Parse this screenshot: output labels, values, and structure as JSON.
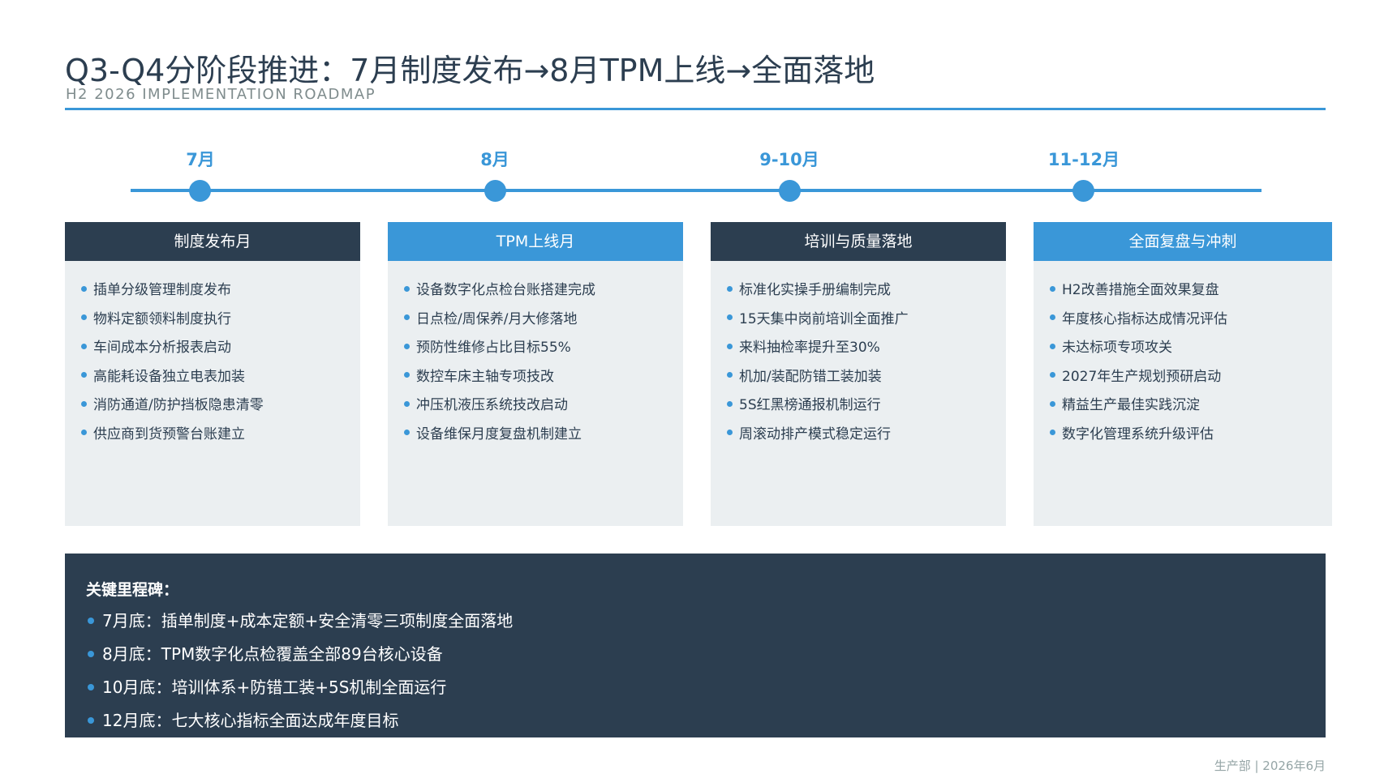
{
  "header": {
    "title": "Q3-Q4分阶段推进：7月制度发布→8月TPM上线→全面落地",
    "subtitle": "H2 2026 IMPLEMENTATION ROADMAP"
  },
  "timeline": {
    "months": [
      "7月",
      "8月",
      "9-10月",
      "11-12月"
    ]
  },
  "phases": [
    {
      "title": "制度发布月",
      "items": [
        "插单分级管理制度发布",
        "物料定额领料制度执行",
        "车间成本分析报表启动",
        "高能耗设备独立电表加装",
        "消防通道/防护挡板隐患清零",
        "供应商到货预警台账建立"
      ]
    },
    {
      "title": "TPM上线月",
      "items": [
        "设备数字化点检台账搭建完成",
        "日点检/周保养/月大修落地",
        "预防性维修占比目标55%",
        "数控车床主轴专项技改",
        "冲压机液压系统技改启动",
        "设备维保月度复盘机制建立"
      ]
    },
    {
      "title": "培训与质量落地",
      "items": [
        "标准化实操手册编制完成",
        "15天集中岗前培训全面推广",
        "来料抽检率提升至30%",
        "机加/装配防错工装加装",
        "5S红黑榜通报机制运行",
        "周滚动排产模式稳定运行"
      ]
    },
    {
      "title": "全面复盘与冲刺",
      "items": [
        "H2改善措施全面效果复盘",
        "年度核心指标达成情况评估",
        "未达标项专项攻关",
        "2027年生产规划预研启动",
        "精益生产最佳实践沉淀",
        "数字化管理系统升级评估"
      ]
    }
  ],
  "milestones": {
    "title": "关键里程碑：",
    "items": [
      "7月底：插单制度+成本定额+安全清零三项制度全面落地",
      "8月底：TPM数字化点检覆盖全部89台核心设备",
      "10月底：培训体系+防错工装+5S机制全面运行",
      "12月底：七大核心指标全面达成年度目标"
    ]
  },
  "footer": "生产部 | 2026年6月",
  "colors": {
    "accent": "#3a97d8",
    "dark": "#2c3e50",
    "card_bg": "#ebeff1"
  }
}
